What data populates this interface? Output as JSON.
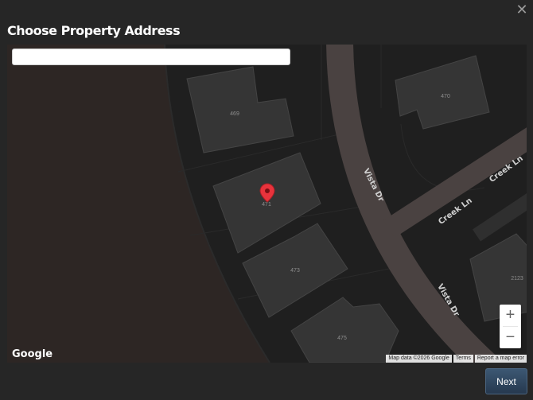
{
  "dialog": {
    "title": "Choose Property Address",
    "close_glyph": "✕",
    "next_label": "Next"
  },
  "search": {
    "value": "",
    "placeholder": ""
  },
  "map": {
    "parcels": [
      "469",
      "471",
      "473",
      "475",
      "470",
      "2123"
    ],
    "streets": [
      "Vista Dr",
      "Vista Dr",
      "Creek Ln",
      "Creek Ln"
    ],
    "zoom_in": "+",
    "zoom_out": "−",
    "logo": "Google",
    "attribution": {
      "data": "Map data ©2026 Google",
      "terms": "Terms",
      "report": "Report a map error"
    },
    "marker_color": "#e8333c",
    "lot_color": "#353535",
    "street_color": "#4a4241",
    "field_color": "#2d2624"
  }
}
